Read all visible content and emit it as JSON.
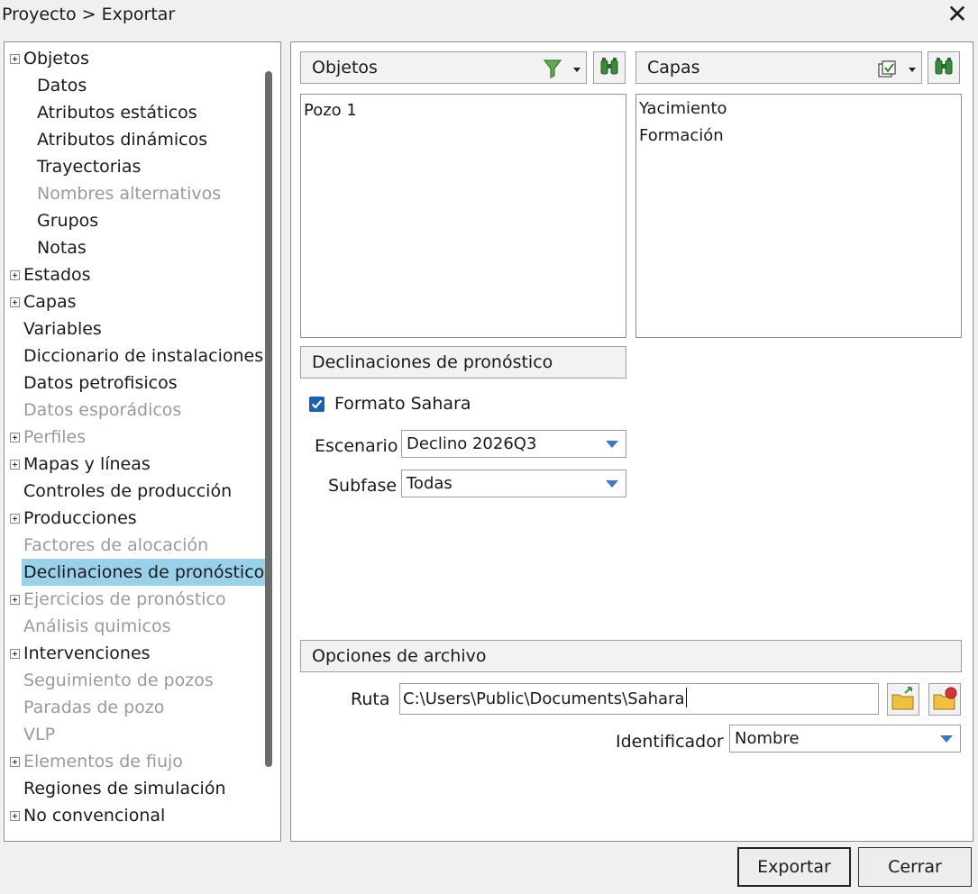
{
  "window": {
    "title": "Proyecto > Exportar",
    "close_glyph": "✕"
  },
  "tree": {
    "items": [
      {
        "label": "Objetos",
        "expandable": true,
        "disabled": false
      },
      {
        "label": "Datos",
        "expandable": false,
        "disabled": false
      },
      {
        "label": "Atributos estáticos",
        "expandable": false,
        "disabled": false
      },
      {
        "label": "Atributos dinámicos",
        "expandable": false,
        "disabled": false
      },
      {
        "label": "Trayectorias",
        "expandable": false,
        "disabled": false
      },
      {
        "label": "Nombres alternativos",
        "expandable": false,
        "disabled": true
      },
      {
        "label": "Grupos",
        "expandable": false,
        "disabled": false
      },
      {
        "label": "Notas",
        "expandable": false,
        "disabled": false
      },
      {
        "label": "Estados",
        "expandable": true,
        "disabled": false
      },
      {
        "label": "Capas",
        "expandable": true,
        "disabled": false
      },
      {
        "label": "Variables",
        "expandable": false,
        "disabled": false
      },
      {
        "label": "Diccionario de instalaciones",
        "expandable": false,
        "disabled": false
      },
      {
        "label": "Datos petrofisicos",
        "expandable": false,
        "disabled": false
      },
      {
        "label": "Datos esporádicos",
        "expandable": false,
        "disabled": true
      },
      {
        "label": "Perfiles",
        "expandable": true,
        "disabled": true
      },
      {
        "label": "Mapas y líneas",
        "expandable": true,
        "disabled": false
      },
      {
        "label": "Controles de producción",
        "expandable": false,
        "disabled": false
      },
      {
        "label": "Producciones",
        "expandable": true,
        "disabled": false
      },
      {
        "label": "Factores de alocación",
        "expandable": false,
        "disabled": true
      },
      {
        "label": "Declinaciones de pronóstico",
        "expandable": false,
        "disabled": false,
        "selected": true
      },
      {
        "label": "Ejercicios de pronóstico",
        "expandable": true,
        "disabled": true
      },
      {
        "label": "Análisis quimicos",
        "expandable": false,
        "disabled": true
      },
      {
        "label": "Intervenciones",
        "expandable": true,
        "disabled": false
      },
      {
        "label": "Seguimiento de pozos",
        "expandable": false,
        "disabled": true
      },
      {
        "label": "Paradas de pozo",
        "expandable": false,
        "disabled": true
      },
      {
        "label": "VLP",
        "expandable": false,
        "disabled": true
      },
      {
        "label": "Elementos de fiujo",
        "expandable": true,
        "disabled": true
      },
      {
        "label": "Regiones de simulación",
        "expandable": false,
        "disabled": false
      },
      {
        "label": "No convencional",
        "expandable": true,
        "disabled": false
      }
    ]
  },
  "objetos_panel": {
    "header": "Objetos",
    "items": [
      "Pozo 1"
    ]
  },
  "capas_panel": {
    "header": "Capas",
    "items": [
      "Yacimiento",
      "Formación"
    ]
  },
  "declinaciones": {
    "header": "Declinaciones de pronóstico",
    "format_checkbox_label": "Formato Sahara",
    "format_checked": true,
    "scenario_label": "Escenario",
    "scenario_value": "Declino 2026Q3",
    "subphase_label": "Subfase",
    "subphase_value": "Todas"
  },
  "file_options": {
    "header": "Opciones de archivo",
    "path_label": "Ruta",
    "path_value": "C:\\Users\\Public\\Documents\\Sahara",
    "identifier_label": "Identificador",
    "identifier_value": "Nombre"
  },
  "buttons": {
    "export": "Exportar",
    "close": "Cerrar"
  }
}
